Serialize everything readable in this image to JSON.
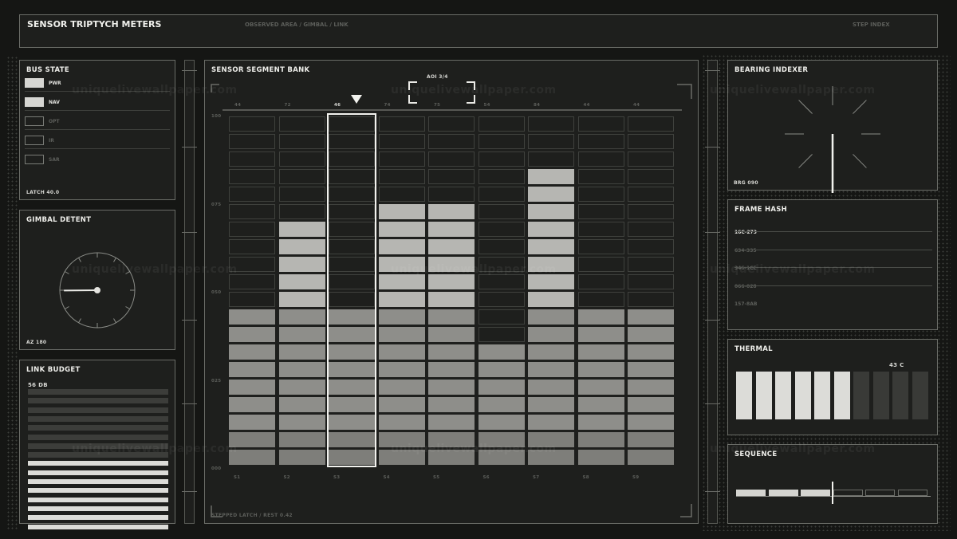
{
  "header": {
    "title": "SENSOR TRIPTYCH METERS",
    "center_label": "OBSERVED AREA / GIMBAL / LINK",
    "right_label": "STEP INDEX"
  },
  "bus_state": {
    "title": "BUS STATE",
    "items": [
      {
        "label": "PWR",
        "on": true
      },
      {
        "label": "NAV",
        "on": true
      },
      {
        "label": "OPT",
        "on": false
      },
      {
        "label": "IR",
        "on": false
      },
      {
        "label": "SAR",
        "on": false
      }
    ],
    "footer": "LATCH 40.0"
  },
  "gimbal": {
    "title": "GIMBAL DETENT",
    "footer": "AZ 180",
    "needle_angle_deg": 275
  },
  "link_budget": {
    "title": "LINK BUDGET",
    "value": "56 DB",
    "bars_total": 16,
    "bars_dim": 8
  },
  "bank": {
    "title": "SENSOR SEGMENT BANK",
    "aoi_label": "AOI 3/4",
    "footer": "STEPPED LATCH / REST 0.42",
    "top_values": [
      "44",
      "72",
      "46",
      "74",
      "75",
      "54",
      "84",
      "44",
      "44"
    ],
    "channels": [
      "S1",
      "S2",
      "S3",
      "S4",
      "S5",
      "S6",
      "S7",
      "S8",
      "S9"
    ],
    "y_ticks": [
      "100",
      "075",
      "050",
      "025",
      "000"
    ],
    "selected_index": 2,
    "rows": 20,
    "levels": [
      9,
      14,
      9,
      15,
      15,
      7,
      17,
      9,
      9
    ],
    "gap_channel": 5,
    "gap_rows": [
      8,
      9
    ]
  },
  "bearing": {
    "title": "BEARING INDEXER",
    "footer": "BRG 090"
  },
  "frame_hash": {
    "title": "FRAME HASH",
    "rows": [
      "16C-273",
      "634-335",
      "346-1CE",
      "066-028",
      "157-8AB"
    ],
    "active_index": 0
  },
  "thermal": {
    "title": "THERMAL",
    "value": "43 C",
    "bars_total": 10,
    "bars_lit": 6
  },
  "sequence": {
    "title": "SEQUENCE",
    "steps_total": 6,
    "steps_done": 3
  },
  "colors": {
    "background": "#151614",
    "panel": "#1e1f1d",
    "border": "#6a6c67",
    "lit_high": "#b8b8b4",
    "lit_low": "#8f8f8b",
    "bright": "#dcdcd8"
  },
  "watermark": "uniquelivewallpaper.com"
}
